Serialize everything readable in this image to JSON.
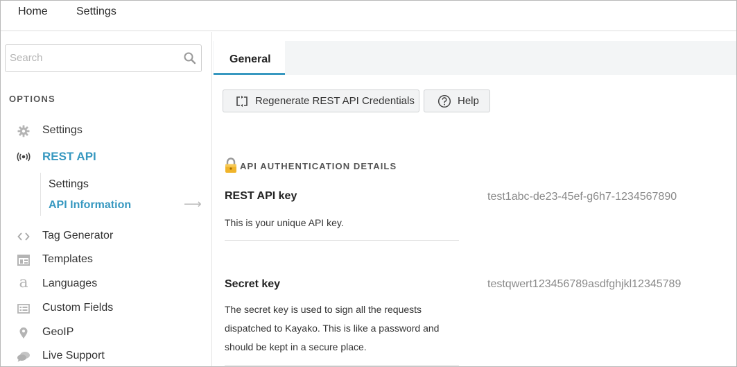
{
  "topnav": {
    "home": "Home",
    "settings": "Settings"
  },
  "sidebar": {
    "search_placeholder": "Search",
    "options_heading": "OPTIONS",
    "items": [
      {
        "label": "Settings",
        "icon": "gear-icon"
      },
      {
        "label": "REST API",
        "icon": "broadcast-icon"
      },
      {
        "label": "Tag Generator",
        "icon": "code-brackets-icon"
      },
      {
        "label": "Templates",
        "icon": "template-icon"
      },
      {
        "label": "Languages",
        "icon": "language-icon"
      },
      {
        "label": "Custom Fields",
        "icon": "list-icon"
      },
      {
        "label": "GeoIP",
        "icon": "map-pin-icon"
      },
      {
        "label": "Live Support",
        "icon": "chat-icon"
      }
    ],
    "sub_items": [
      {
        "label": "Settings"
      },
      {
        "label": "API Information"
      }
    ],
    "active_item": "REST API",
    "active_sub_item": "API Information"
  },
  "main": {
    "tabs": [
      {
        "label": "General"
      }
    ],
    "buttons": {
      "regenerate": "Regenerate REST API Credentials",
      "help": "Help"
    },
    "section_title": "API AUTHENTICATION DETAILS",
    "fields": [
      {
        "label": "REST API key",
        "description": "This is your unique API key.",
        "value": "test1abc-de23-45ef-g6h7-1234567890"
      },
      {
        "label": "Secret key",
        "description": "The secret key is used to sign all the requests dispatched to Kayako. This is like a password and should be kept in a secure place.",
        "value": "testqwert123456789asdfghjkl12345789"
      }
    ]
  },
  "colors": {
    "accent": "#3798c0",
    "tab_bar_bg": "#f3f5f6",
    "value_text": "#8a8a8a"
  }
}
